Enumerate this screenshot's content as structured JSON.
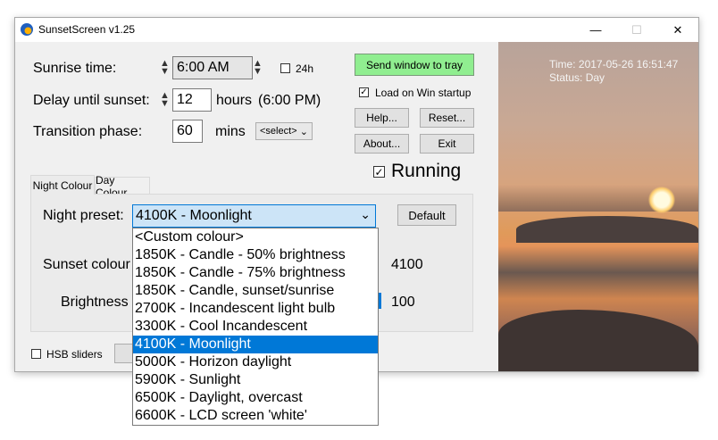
{
  "window": {
    "title": "SunsetScreen v1.25",
    "minimize": "—",
    "maximize": "☐",
    "close": "✕"
  },
  "settings": {
    "sunrise_label": "Sunrise time:",
    "sunrise_value": "6:00 AM",
    "h24_label": "24h",
    "delay_label": "Delay until sunset:",
    "delay_value": "12",
    "delay_unit": "hours",
    "delay_result": "(6:00 PM)",
    "transition_label": "Transition phase:",
    "transition_value": "60",
    "transition_unit": "mins",
    "transition_select": "<select>"
  },
  "actions": {
    "send_to_tray": "Send window to tray",
    "load_startup": "Load on Win startup",
    "load_startup_checked": true,
    "help": "Help...",
    "reset": "Reset...",
    "about": "About...",
    "exit": "Exit",
    "running_label": "Running",
    "running_checked": true
  },
  "status": {
    "time": "Time: 2017-05-26 16:51:47",
    "status": "Status: Day"
  },
  "tabs": [
    {
      "label": "Night Colour",
      "active": true
    },
    {
      "label": "Day Colour",
      "active": false
    }
  ],
  "night": {
    "preset_label": "Night preset:",
    "preset_value": "4100K - Moonlight",
    "default_button": "Default",
    "sunset_colour_label": "Sunset colour",
    "sunset_colour_value": "4100",
    "brightness_label": "Brightness",
    "brightness_value": "100"
  },
  "bottom": {
    "hsb_label": "HSB sliders"
  },
  "preset_options": [
    "<Custom colour>",
    "1850K - Candle - 50% brightness",
    "1850K - Candle - 75% brightness",
    "1850K - Candle, sunset/sunrise",
    "2700K - Incandescent light bulb",
    "3300K - Cool Incandescent",
    "4100K - Moonlight",
    "5000K - Horizon daylight",
    "5900K - Sunlight",
    "6500K - Daylight, overcast",
    "6600K - LCD screen 'white'"
  ],
  "preset_selected_index": 6,
  "colors": {
    "tray_button": "#90ee90",
    "selection": "#0078d7"
  }
}
